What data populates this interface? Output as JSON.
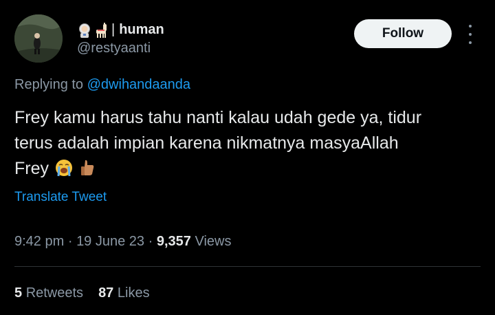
{
  "user": {
    "name": "human",
    "name_emojis": [
      "astronaut",
      "llama"
    ],
    "handle": "@restyaanti"
  },
  "follow_label": "Follow",
  "reply": {
    "prefix": "Replying to",
    "mention": "@dwihandaanda"
  },
  "tweet": {
    "lines": [
      "Frey kamu harus tahu nanti kalau udah gede ya, tidur",
      "terus adalah impian karena nikmatnya masyaAllah",
      "Frey"
    ],
    "trailing_emojis": [
      "loudly-crying-face",
      "thumbs-up"
    ]
  },
  "translate_label": "Translate Tweet",
  "meta": {
    "time": "9:42 pm",
    "date": "19 June 23",
    "views_count": "9,357",
    "views_label": "Views"
  },
  "stats": {
    "retweets_count": "5",
    "retweets_label": "Retweets",
    "likes_count": "87",
    "likes_label": "Likes"
  },
  "colors": {
    "background": "#000000",
    "text": "#e7e9ea",
    "secondary": "#8b98a5",
    "link": "#1d9bf0",
    "divider": "#2f3336",
    "button_bg": "#eff3f4"
  }
}
